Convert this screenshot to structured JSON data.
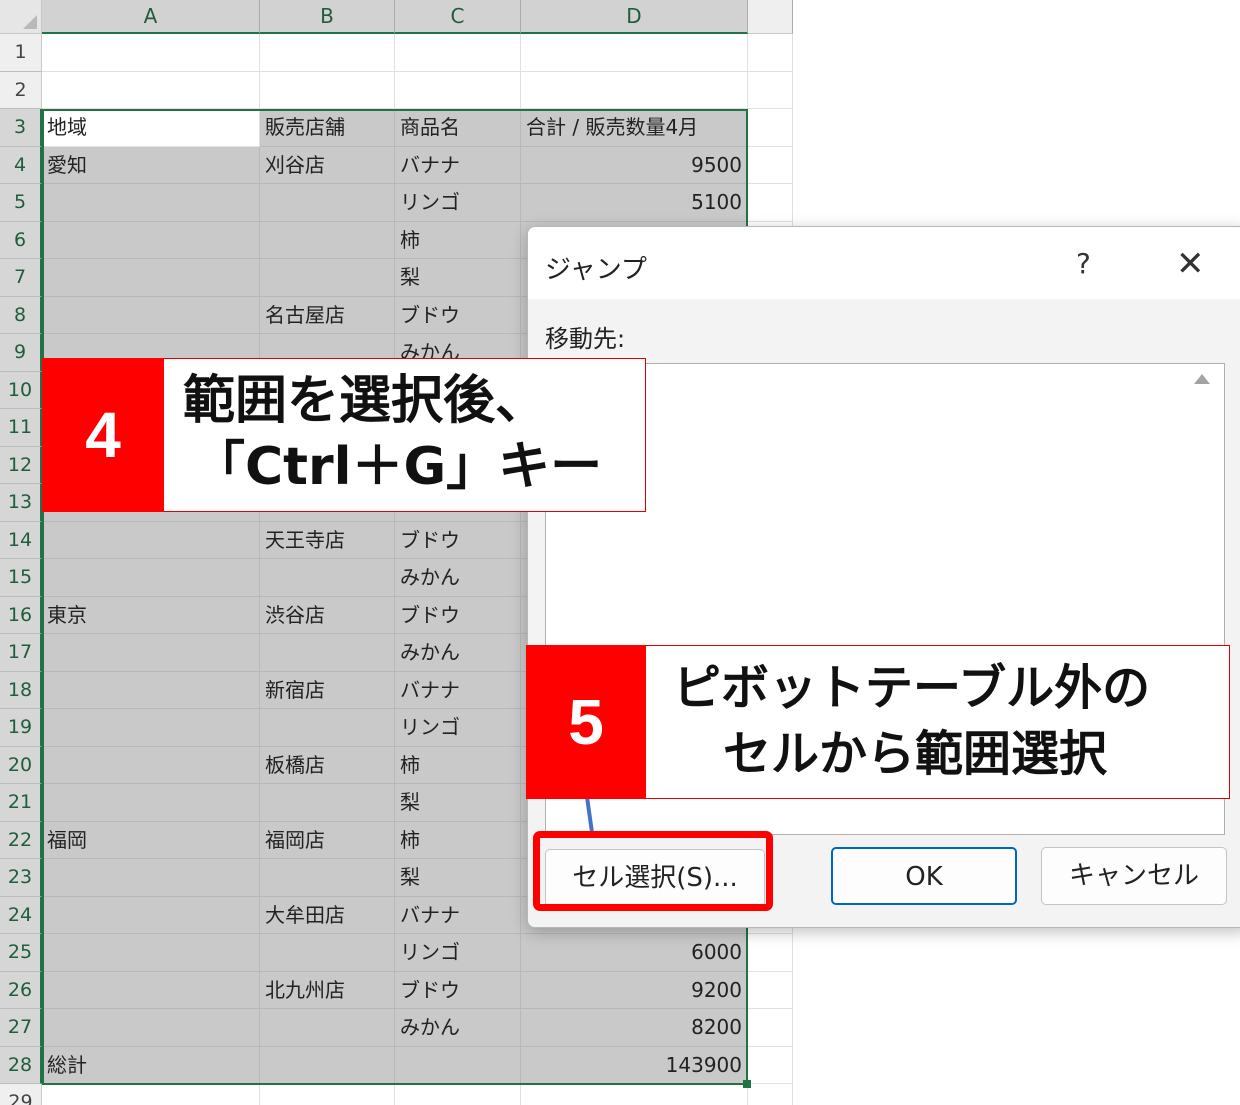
{
  "sheet": {
    "columns": [
      "A",
      "B",
      "C",
      "D"
    ],
    "rows": [
      {
        "n": "1",
        "a": "",
        "b": "",
        "c": "",
        "d": ""
      },
      {
        "n": "2",
        "a": "",
        "b": "",
        "c": "",
        "d": ""
      },
      {
        "n": "3",
        "a": "地域",
        "b": "販売店舗",
        "c": "商品名",
        "d": "合計 / 販売数量4月"
      },
      {
        "n": "4",
        "a": "愛知",
        "b": "刈谷店",
        "c": "バナナ",
        "d": "9500"
      },
      {
        "n": "5",
        "a": "",
        "b": "",
        "c": "リンゴ",
        "d": "5100"
      },
      {
        "n": "6",
        "a": "",
        "b": "",
        "c": "柿",
        "d": ""
      },
      {
        "n": "7",
        "a": "",
        "b": "",
        "c": "梨",
        "d": ""
      },
      {
        "n": "8",
        "a": "",
        "b": "名古屋店",
        "c": "ブドウ",
        "d": ""
      },
      {
        "n": "9",
        "a": "",
        "b": "",
        "c": "みかん",
        "d": ""
      },
      {
        "n": "10",
        "a": "",
        "b": "",
        "c": "",
        "d": ""
      },
      {
        "n": "11",
        "a": "",
        "b": "",
        "c": "",
        "d": ""
      },
      {
        "n": "12",
        "a": "",
        "b": "",
        "c": "",
        "d": ""
      },
      {
        "n": "13",
        "a": "",
        "b": "",
        "c": "",
        "d": ""
      },
      {
        "n": "14",
        "a": "",
        "b": "天王寺店",
        "c": "ブドウ",
        "d": ""
      },
      {
        "n": "15",
        "a": "",
        "b": "",
        "c": "みかん",
        "d": ""
      },
      {
        "n": "16",
        "a": "東京",
        "b": "渋谷店",
        "c": "ブドウ",
        "d": ""
      },
      {
        "n": "17",
        "a": "",
        "b": "",
        "c": "みかん",
        "d": ""
      },
      {
        "n": "18",
        "a": "",
        "b": "新宿店",
        "c": "バナナ",
        "d": ""
      },
      {
        "n": "19",
        "a": "",
        "b": "",
        "c": "リンゴ",
        "d": ""
      },
      {
        "n": "20",
        "a": "",
        "b": "板橋店",
        "c": "柿",
        "d": ""
      },
      {
        "n": "21",
        "a": "",
        "b": "",
        "c": "梨",
        "d": ""
      },
      {
        "n": "22",
        "a": "福岡",
        "b": "福岡店",
        "c": "柿",
        "d": ""
      },
      {
        "n": "23",
        "a": "",
        "b": "",
        "c": "梨",
        "d": ""
      },
      {
        "n": "24",
        "a": "",
        "b": "大牟田店",
        "c": "バナナ",
        "d": ""
      },
      {
        "n": "25",
        "a": "",
        "b": "",
        "c": "リンゴ",
        "d": "6000"
      },
      {
        "n": "26",
        "a": "",
        "b": "北九州店",
        "c": "ブドウ",
        "d": "9200"
      },
      {
        "n": "27",
        "a": "",
        "b": "",
        "c": "みかん",
        "d": "8200"
      },
      {
        "n": "28",
        "a": "総計",
        "b": "",
        "c": "",
        "d": "143900"
      },
      {
        "n": "29",
        "a": "",
        "b": "",
        "c": "",
        "d": ""
      }
    ]
  },
  "dialog": {
    "title": "ジャンプ",
    "help": "?",
    "close": "✕",
    "goto_label": "移動先:",
    "reference_value": "",
    "special_button": "セル選択(S)...",
    "ok_button": "OK",
    "cancel_button": "キャンセル"
  },
  "callouts": {
    "step4_number": "4",
    "step4_line1": "範囲を選択後、",
    "step4_line2": "「Ctrl＋G」キー",
    "step5_number": "5",
    "step5_line1": "ピボットテーブル外の",
    "step5_line2": "セルから範囲選択"
  },
  "colors": {
    "excel_green": "#217346",
    "selection_gray": "#c9c9c9",
    "callout_red": "#ff0000",
    "ok_blue": "#0067c0"
  }
}
